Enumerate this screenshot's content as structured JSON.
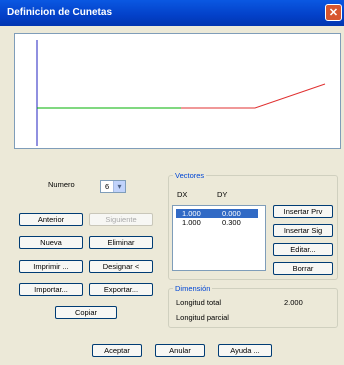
{
  "window": {
    "title": "Definicion de Cunetas"
  },
  "numero": {
    "label": "Numero",
    "value": "6"
  },
  "buttons": {
    "anterior": "Anterior",
    "siguiente": "Siguiente",
    "nueva": "Nueva",
    "eliminar": "Eliminar",
    "imprimir": "Imprimir ...",
    "designar": "Designar <",
    "importar": "Importar...",
    "exportar": "Exportar...",
    "copiar": "Copiar",
    "insertar_prv": "Insertar Prv",
    "insertar_sig": "Insertar Sig",
    "editar": "Editar...",
    "borrar": "Borrar",
    "aceptar": "Aceptar",
    "anular": "Anular",
    "ayuda": "Ayuda ..."
  },
  "vectores": {
    "title": "Vectores",
    "col_dx": "DX",
    "col_dy": "DY",
    "rows": [
      {
        "dx": "1.000",
        "dy": "0.000",
        "selected": true
      },
      {
        "dx": "1.000",
        "dy": "0.300",
        "selected": false
      }
    ]
  },
  "dimension": {
    "title": "Dimensión",
    "longitud_total_label": "Longitud total",
    "longitud_total_value": "2.000",
    "longitud_parcial_label": "Longitud parcial"
  },
  "colors": {
    "axis_vertical": "#2020c0",
    "axis_horizontal": "#00b000",
    "profile": "#e03030"
  }
}
